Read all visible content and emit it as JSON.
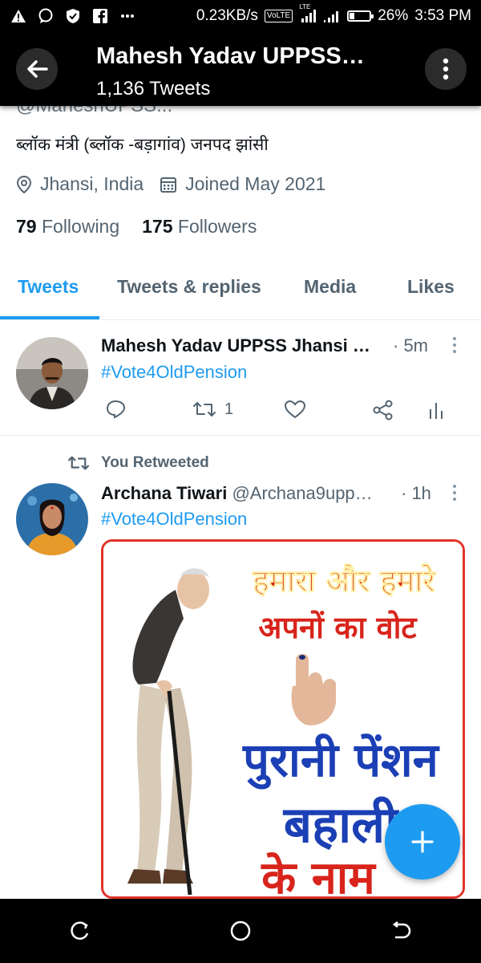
{
  "status_bar": {
    "speed": "0.23KB/s",
    "volte": "VoLTE",
    "lte": "LTE",
    "battery": "26%",
    "battery_level": 0.26,
    "time": "3:53 PM",
    "icons": [
      "alert-icon",
      "message-icon",
      "shield-icon",
      "facebook-icon",
      "more-notifications-icon",
      "volte-icon",
      "signal-icon",
      "signal-icon-2",
      "battery-icon"
    ]
  },
  "header": {
    "title": "Mahesh Yadav UPPSS…",
    "subtitle": "1,136 Tweets"
  },
  "profile": {
    "handle_partial": "@MaheshUPSS...",
    "bio": "ब्लॉक मंत्री (ब्लॉक -बड़ागांव) जनपद झांसी",
    "location": "Jhansi, India",
    "joined": "Joined May 2021",
    "following_count": "79",
    "following_label": "Following",
    "followers_count": "175",
    "followers_label": "Followers"
  },
  "tabs": [
    {
      "label": "Tweets",
      "active": true
    },
    {
      "label": "Tweets & replies",
      "active": false
    },
    {
      "label": "Media",
      "active": false
    },
    {
      "label": "Likes",
      "active": false
    }
  ],
  "tweets": [
    {
      "author": "Mahesh Yadav UPPSS Jhansi …",
      "time": "· 5m",
      "text": "#Vote4OldPension",
      "retweet_count": "1"
    },
    {
      "retweeted_label": "You Retweeted",
      "author": "Archana Tiwari",
      "handle": "@Archana9upp…",
      "time": "· 1h",
      "text": "#Vote4OldPension",
      "image_text": {
        "line1": "हमारा और हमारे",
        "line2": "अपनों का वोट",
        "line3": "पुरानी पेंशन",
        "line4": "बहाली",
        "line5": "के नाम"
      }
    }
  ],
  "colors": {
    "accent": "#1d9bf0",
    "poster_red": "#d8241b",
    "poster_blue": "#1b3fb5"
  }
}
